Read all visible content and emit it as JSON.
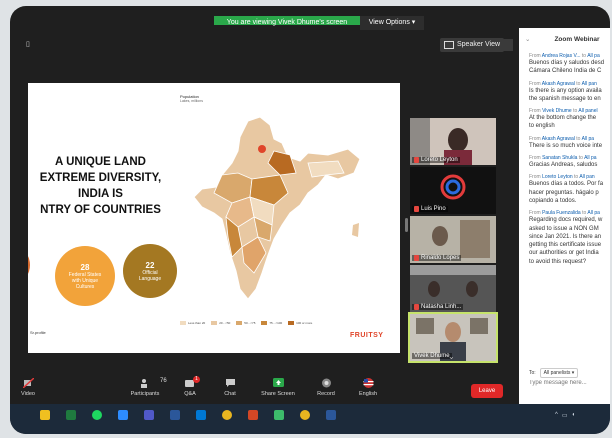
{
  "banner": {
    "message": "You are viewing Vivek Dhume's screen",
    "options": "View Options ▾"
  },
  "view": {
    "speaker_view": "Speaker View"
  },
  "slide": {
    "title_lines": [
      "A UNIQUE LAND",
      "EXTREME DIVERSITY,",
      "INDIA IS",
      "NTRY OF COUNTRIES"
    ],
    "stat1": {
      "number": "28",
      "text": "Federal States with Unique Cultures"
    },
    "stat2": {
      "number": "22",
      "text": "Official Language"
    },
    "attribution": "Sr.profile",
    "map_title": "Population",
    "map_subtitle": "Lakes, millions",
    "legend": [
      "Less than 20",
      "20 - <50",
      "50 - <75",
      "75 - <100",
      "100 or more"
    ],
    "brand": "FRUITSY",
    "colors": {
      "orange": "#f2a33a",
      "brown": "#a47822",
      "dark_orange": "#d86b2f"
    }
  },
  "participants_video": [
    {
      "name": "Loreto Leyton"
    },
    {
      "name": "Luis Pino"
    },
    {
      "name": "Rinaldo Lopes"
    },
    {
      "name": "Natasha Linh..."
    },
    {
      "name": "Vivek Dhume"
    }
  ],
  "toolbar": {
    "video": "Video",
    "participants": "Participants",
    "participants_count": "76",
    "qa": "Q&A",
    "qa_badge": "1",
    "chat": "Chat",
    "share_screen": "Share Screen",
    "record": "Record",
    "english": "English",
    "leave": "Leave"
  },
  "chat": {
    "title": "Zoom Webinar",
    "messages": [
      {
        "from": "Andrea Rojas V...",
        "to": "All pa",
        "lines": [
          "Buenos días y saludos desd",
          "Cámara Chileno India de C"
        ]
      },
      {
        "from": "Akash Agrawal",
        "to": "All pan",
        "lines": [
          "Is there is any option availa",
          "the spanish message to en"
        ]
      },
      {
        "from": "Vivek Dhume",
        "to": "All panel",
        "lines": [
          "At the bottom change the",
          "to english"
        ]
      },
      {
        "from": "Akash Agrawal",
        "to": "All pa",
        "lines": [
          "There is so much voice inte"
        ]
      },
      {
        "from": "Sanatan Shukla",
        "to": "All pa",
        "lines": [
          "Gracias Andreas, saludos"
        ]
      },
      {
        "from": "Loreto Leyton",
        "to": "All pan",
        "lines": [
          "Buenos días a todos. Por fa",
          "hacer preguntas. hágalo p",
          "copiando a todos."
        ]
      },
      {
        "from": "Paula Fuenzalida",
        "to": "All pa",
        "lines": [
          "Regarding docs required, w",
          "asked to issue a NON GM",
          "since Jan 2021. Is there an",
          "getting this certificate issue",
          "our authorities or get India",
          "to avoid this request?"
        ]
      }
    ],
    "from_label": "From",
    "to_label": "to",
    "to_prefix": "To:",
    "to_value": "All panelists ▾",
    "input_placeholder": "Type message here..."
  }
}
